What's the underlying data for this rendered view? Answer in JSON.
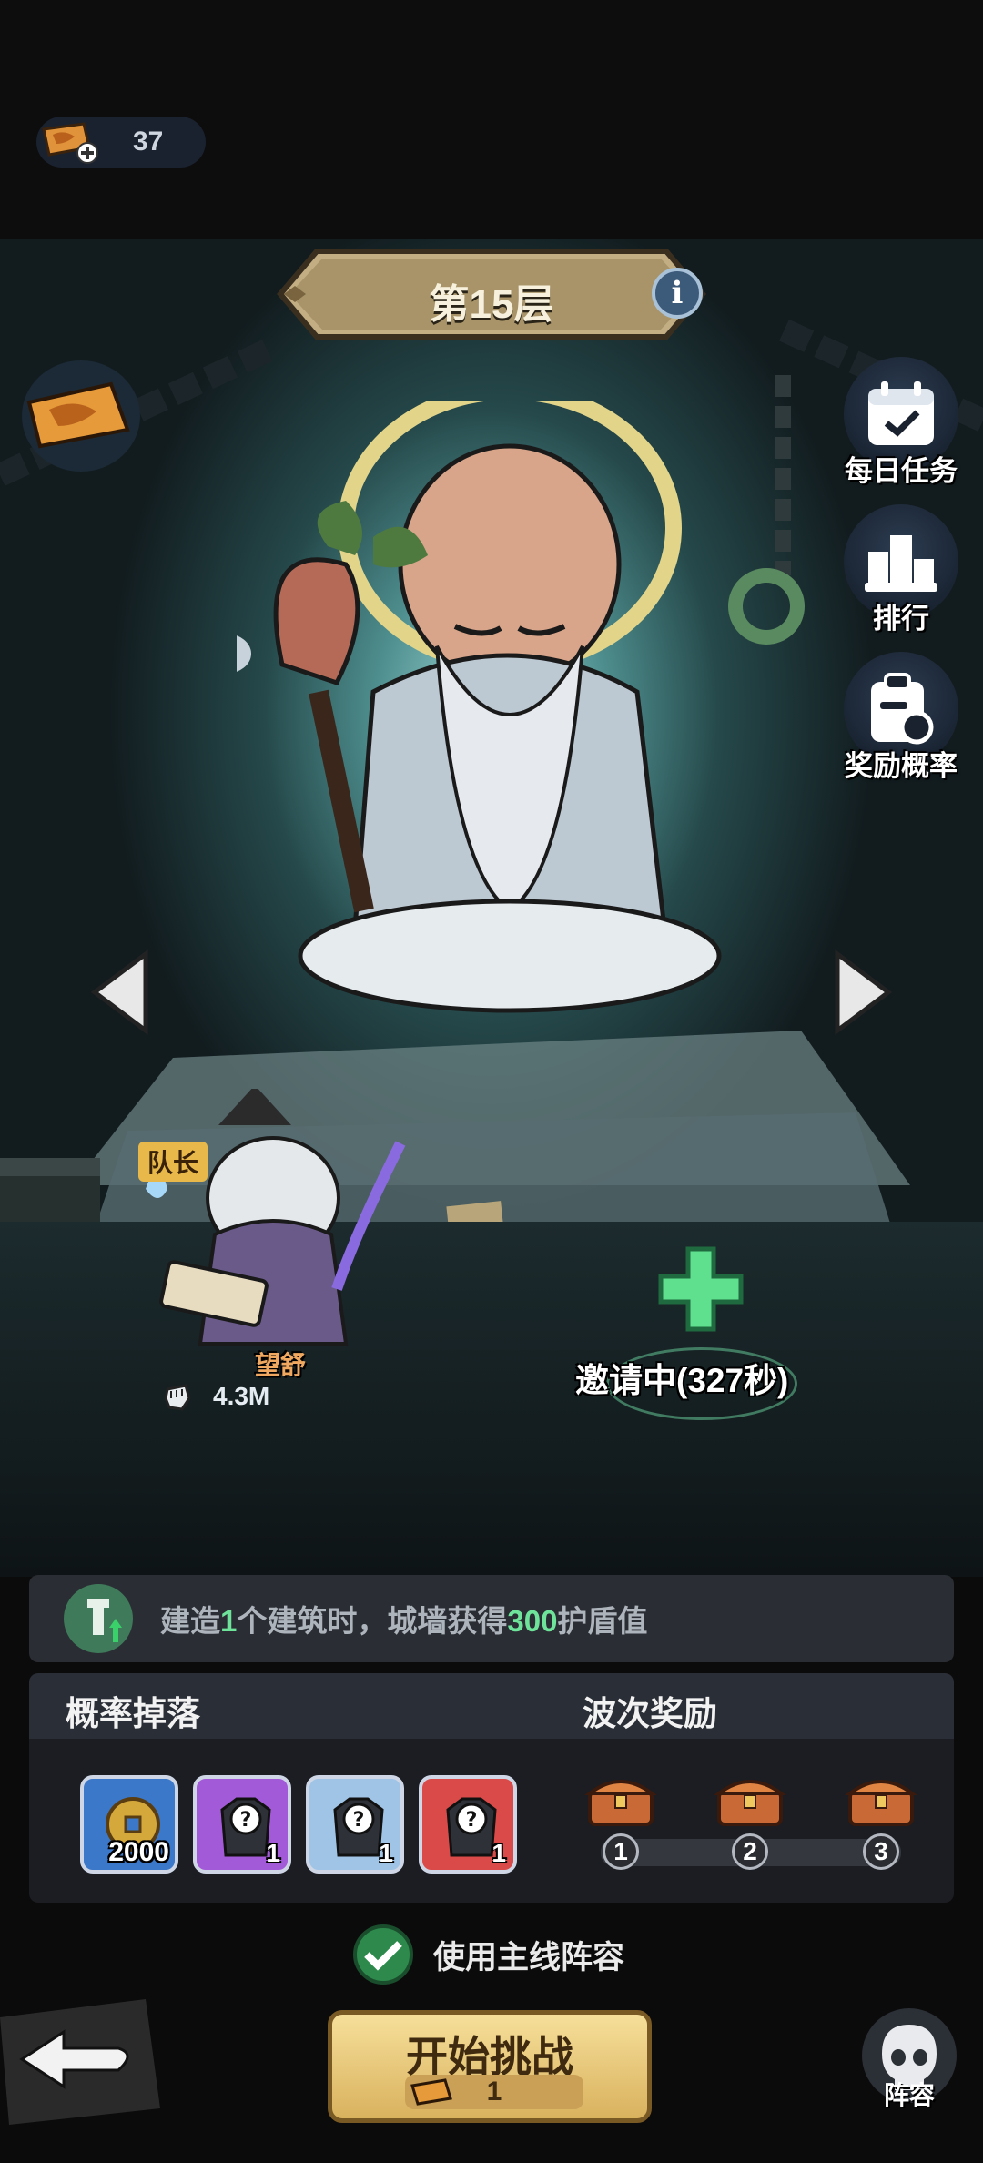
{
  "top_bar": {
    "tickets": "37"
  },
  "floor": {
    "title": "第15层"
  },
  "side_menu": {
    "daily_tasks": "每日任务",
    "ranking": "排行",
    "reward_rate": "奖励概率"
  },
  "party": {
    "captain_tag": "队长",
    "hero_name": "望舒",
    "power": "4.3M",
    "invite_status": "邀请中(327秒)"
  },
  "buff": {
    "prefix": "建造",
    "count": "1",
    "mid": "个建筑时，城墙获得",
    "value": "300",
    "suffix": "护盾值"
  },
  "rewards": {
    "drops_title": "概率掉落",
    "wave_title": "波次奖励",
    "items": [
      {
        "icon": "coin-icon",
        "count": "2000",
        "color": "#3b78c9"
      },
      {
        "icon": "mystery-armor-icon",
        "count": "1",
        "color": "#a35ad8"
      },
      {
        "icon": "mystery-armor-icon",
        "count": "1",
        "color": "#9fc4e6"
      },
      {
        "icon": "mystery-armor-icon",
        "count": "1",
        "color": "#d94a48"
      }
    ],
    "waves": [
      "1",
      "2",
      "3"
    ]
  },
  "use_lineup": "使用主线阵容",
  "start": {
    "label": "开始挑战",
    "cost": "1"
  },
  "lineup": "阵容"
}
